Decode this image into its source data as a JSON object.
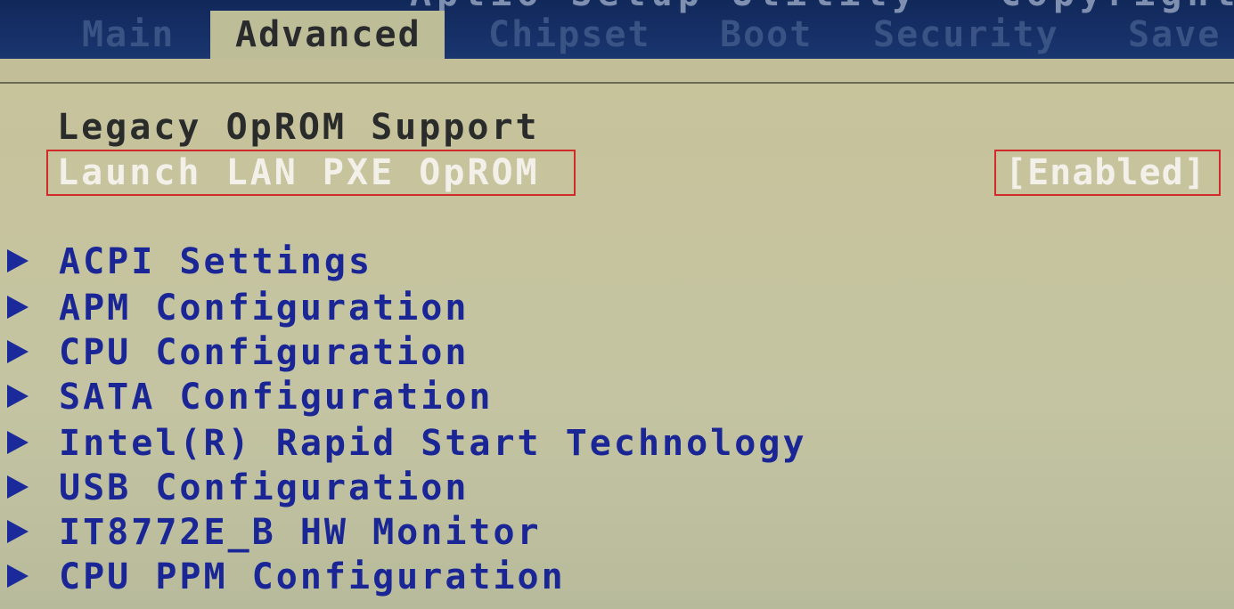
{
  "header": {
    "title": "Aptio Setup Utility - Copyright",
    "tabs": [
      {
        "label": "Main"
      },
      {
        "label": "Advanced"
      },
      {
        "label": "Chipset"
      },
      {
        "label": "Boot"
      },
      {
        "label": "Security"
      },
      {
        "label": "Save"
      }
    ]
  },
  "main": {
    "section_heading": "Legacy OpROM Support",
    "selected_item": {
      "label": "Launch LAN PXE OpROM",
      "value": "[Enabled]"
    },
    "menu_items": [
      {
        "label": "ACPI Settings"
      },
      {
        "label": "APM Configuration"
      },
      {
        "label": "CPU Configuration"
      },
      {
        "label": "SATA Configuration"
      },
      {
        "label": "Intel(R) Rapid Start Technology"
      },
      {
        "label": "USB Configuration"
      },
      {
        "label": "IT8772E_B HW Monitor"
      },
      {
        "label": "CPU PPM Configuration"
      }
    ]
  },
  "colors": {
    "header_bg": "#11285a",
    "content_bg": "#c4c19a",
    "highlight_border": "#d02a2a",
    "submenu_text": "#1a2695",
    "selected_text": "#f2f0e8"
  }
}
